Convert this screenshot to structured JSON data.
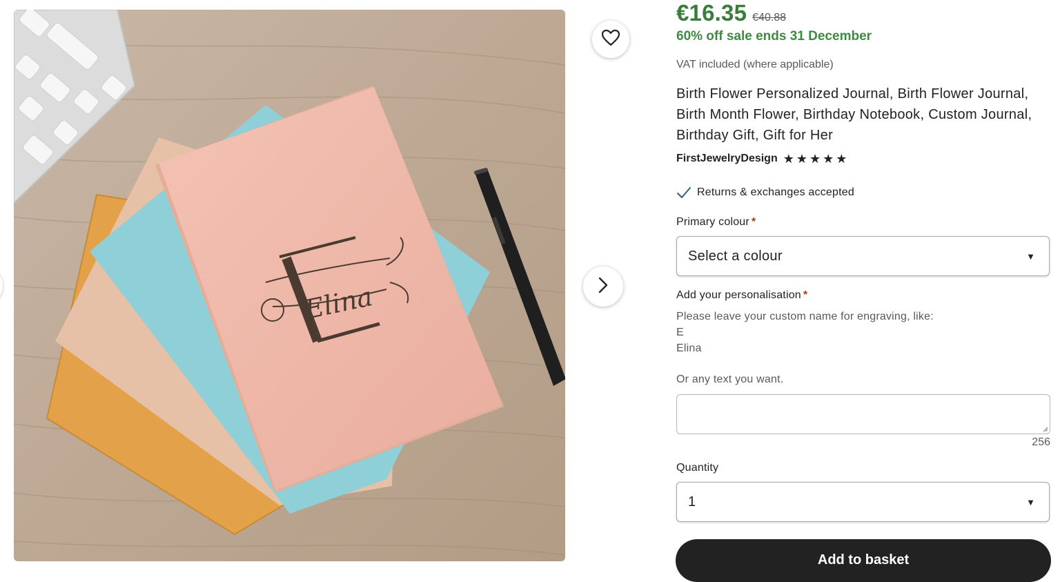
{
  "price": {
    "current": "€16.35",
    "original": "€40.88",
    "sale_text": "60% off sale ends 31 December",
    "vat_text": "VAT included (where applicable)",
    "color": "#3a7d3b"
  },
  "product": {
    "title": "Birth Flower Personalized Journal, Birth Flower Journal, Birth Month Flower, Birthday Notebook, Custom Journal, Birthday Gift, Gift for Her",
    "shop_name": "FirstJewelryDesign",
    "rating_stars": 5,
    "returns_text": "Returns & exchanges accepted",
    "image_engraving": "Elina"
  },
  "options": {
    "colour_label": "Primary colour",
    "colour_value": "Select a colour",
    "personalisation_label": "Add your personalisation",
    "personalisation_help_lines": [
      "Please leave your custom name for engraving, like:",
      "E",
      "Elina",
      "Or any text you want."
    ],
    "personalisation_value": "",
    "char_count": "256",
    "quantity_label": "Quantity",
    "quantity_value": "1",
    "required_mark": "*"
  },
  "actions": {
    "add_to_basket": "Add to basket"
  },
  "icons": {
    "favorite": "heart-outline-icon",
    "next": "chevron-right-icon",
    "returns": "check-icon",
    "star": "star-icon",
    "dropdown": "caret-down-icon"
  }
}
